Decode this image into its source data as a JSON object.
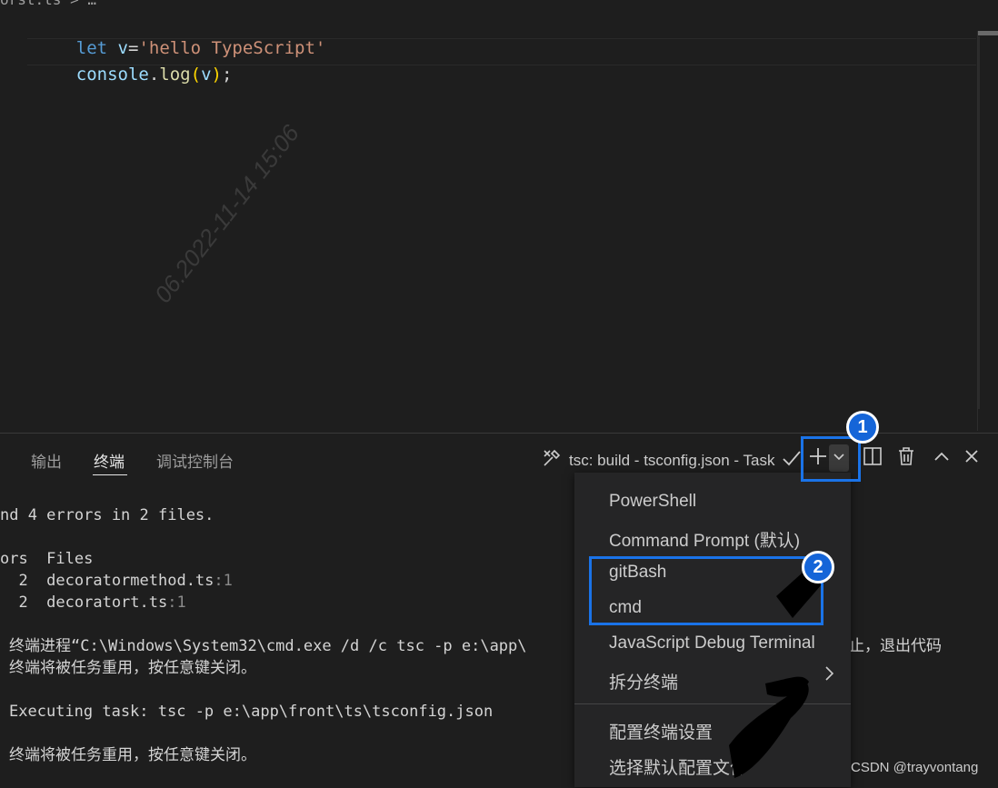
{
  "editor": {
    "breadcrumb": "orst.ts > …",
    "code": {
      "line1": {
        "kw": "let",
        "v": "v",
        "eq": "=",
        "str": "'hello TypeScript'"
      },
      "line2": {
        "obj": "console",
        "dot": ".",
        "fn": "log",
        "lp": "(",
        "arg": "v",
        "rp": ")",
        "semi": ";"
      }
    }
  },
  "panel": {
    "tabs": [
      {
        "label": "输出"
      },
      {
        "label": "终端"
      },
      {
        "label": "调试控制台"
      }
    ],
    "task_label": "tsc: build - tsconfig.json - Task"
  },
  "terminal": {
    "lines": [
      "nd 4 errors in 2 files.",
      "ors  Files",
      "  2  decoratormethod.ts",
      "  2  decoratort.ts",
      "终端进程“C:\\Windows\\System32\\cmd.exe /d /c tsc -p e:\\app\\",
      "终端将被任务重用，按任意键关闭。",
      "Executing task: tsc -p e:\\app\\front\\ts\\tsconfig.json",
      "终端将被任务重用，按任意键关闭。"
    ],
    "line_nums": [
      ":1",
      ":1"
    ],
    "tail_right": "止，退出代码"
  },
  "dropdown": {
    "items": [
      "PowerShell",
      "Command Prompt (默认)",
      "gitBash",
      "cmd",
      "JavaScript Debug Terminal",
      "拆分终端",
      "配置终端设置",
      "选择默认配置文件"
    ]
  },
  "annotations": {
    "badge1": "1",
    "badge2": "2",
    "highlight_color": "#1a73e8"
  },
  "watermark": {
    "credit": "CSDN @trayvontang",
    "stamp": "06.2022-11-14 15:06"
  },
  "icons": [
    "tools-icon",
    "check-icon",
    "plus-icon",
    "chevron-down-icon",
    "split-icon",
    "trash-icon",
    "chevron-up-icon",
    "close-icon",
    "chevron-right-icon"
  ]
}
